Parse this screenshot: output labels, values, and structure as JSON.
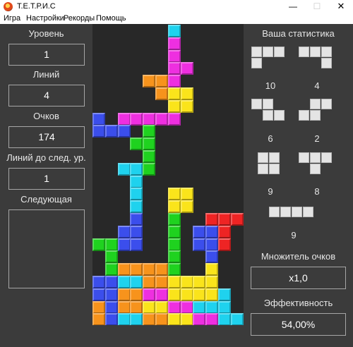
{
  "window": {
    "title": "Т.Е.Т.Р.И.С",
    "minimize": "—",
    "maximize": "☐",
    "close": "✕"
  },
  "menu": [
    "Игра",
    "Настройки",
    "Рекорды",
    "Помощь"
  ],
  "left_panel": {
    "level_label": "Уровень",
    "level_value": "1",
    "lines_label": "Линий",
    "lines_value": "4",
    "score_label": "Очков",
    "score_value": "174",
    "lines_next_label": "Линий до след. ур.",
    "lines_next_value": "1",
    "next_label": "Следующая"
  },
  "right_panel": {
    "stats_title": "Ваша статистика",
    "pieces": [
      {
        "icon": "piece-l-icon",
        "count": "10"
      },
      {
        "icon": "piece-j-icon",
        "count": "4"
      },
      {
        "icon": "piece-z-icon",
        "count": "6"
      },
      {
        "icon": "piece-s-icon",
        "count": "2"
      },
      {
        "icon": "piece-o-icon",
        "count": "9"
      },
      {
        "icon": "piece-t-icon",
        "count": "8"
      },
      {
        "icon": "piece-i-icon",
        "count": "9"
      }
    ],
    "multiplier_label": "Множитель очков",
    "multiplier_value": "x1,0",
    "efficiency_label": "Эффективность",
    "efficiency_value": "54,00%"
  },
  "colors": {
    "C": "#1fd2ee",
    "M": "#ee2fe0",
    "O": "#f7931c",
    "Y": "#fae41b",
    "B": "#3b4eec",
    "G": "#1fd21f",
    "R": "#ee2424"
  },
  "board": {
    "columns": 12,
    "rows": 24,
    "grid": [
      "......C.....",
      "......M.....",
      "......M.....",
      "......MM....",
      "....OOM.....",
      ".....OYY....",
      "......YY....",
      "B.MMMMM.....",
      "BBB.G.......",
      "...GG.......",
      "....G.......",
      "..CCG.......",
      "...C........",
      "...C..YY....",
      "...C..YY....",
      "...B..G..RRR",
      "..BB..G.BBR.",
      "GGBB..G.BBR.",
      ".G....G..B..",
      ".GOOOOG..Y..",
      "BBCCOOYYYY..",
      "BBOOMMYYYYC.",
      "OBOOYYMMCCC.",
      "OBCCOOYYMMCC"
    ]
  }
}
